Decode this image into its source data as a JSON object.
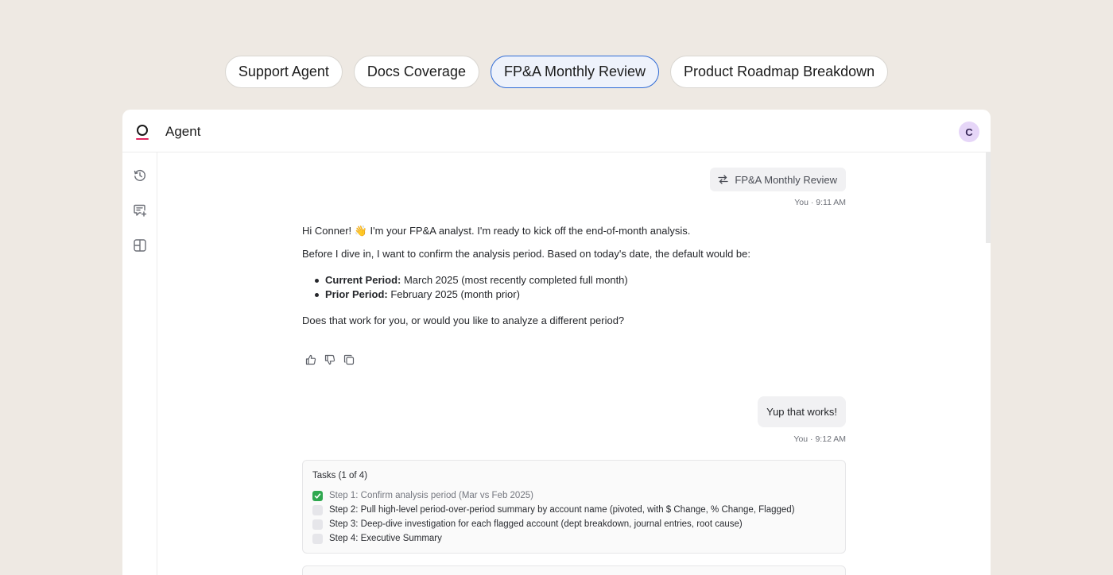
{
  "scenario_tabs": [
    {
      "label": "Support Agent",
      "active": false
    },
    {
      "label": "Docs Coverage",
      "active": false
    },
    {
      "label": "FP&A Monthly Review",
      "active": true
    },
    {
      "label": "Product Roadmap Breakdown",
      "active": false
    }
  ],
  "app": {
    "title": "Agent",
    "avatar_initial": "C",
    "accent_color": "#e0245e"
  },
  "sidebar": {
    "items": [
      {
        "icon": "history-icon"
      },
      {
        "icon": "new-chat-icon"
      },
      {
        "icon": "layout-icon"
      }
    ]
  },
  "chat": {
    "workflow_chip": {
      "label": "FP&A Monthly Review",
      "icon": "workflow-icon"
    },
    "user_meta_1": "You · 9:11 AM",
    "agent_message": {
      "greeting": "Hi Conner! 👋  I'm your FP&A analyst. I'm ready to kick off the end-of-month analysis.",
      "intro": "Before I dive in, I want to confirm the analysis period. Based on today's date, the default would be:",
      "bullets": [
        {
          "label": "Current Period:",
          "value": " March 2025 (most recently completed full month)"
        },
        {
          "label": "Prior Period:",
          "value": " February 2025 (month prior)"
        }
      ],
      "question": "Does that work for you, or would you like to analyze a different period?"
    },
    "actions": [
      "thumbs-up-icon",
      "thumbs-down-icon",
      "copy-icon"
    ],
    "user_reply": "Yup that works!",
    "user_meta_2": "You · 9:12 AM",
    "tasks": {
      "title": "Tasks (1 of 4)",
      "items": [
        {
          "label": "Step 1: Confirm analysis period (Mar vs Feb 2025)",
          "done": true
        },
        {
          "label": "Step 2: Pull high-level period-over-period summary by account name (pivoted, with $ Change, % Change, Flagged)",
          "done": false
        },
        {
          "label": "Step 3: Deep-dive investigation for each flagged account (dept breakdown, journal entries, root cause)",
          "done": false
        },
        {
          "label": "Step 4: Executive Summary",
          "done": false
        }
      ]
    }
  }
}
